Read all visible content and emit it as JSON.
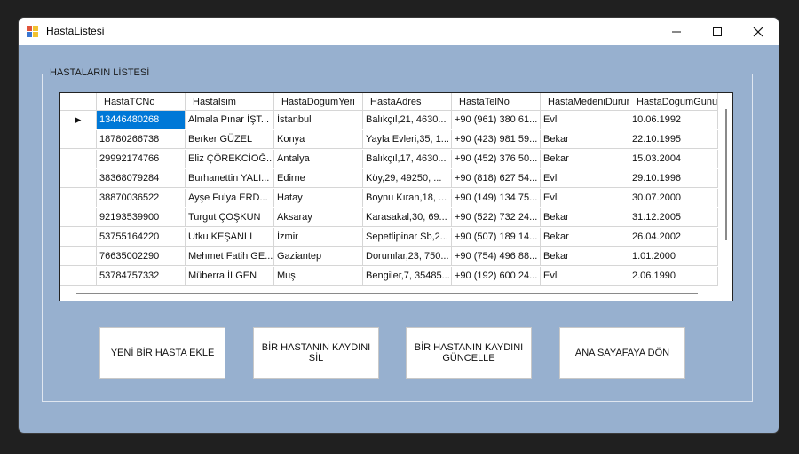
{
  "window": {
    "title": "HastaListesi"
  },
  "controls": {
    "minimize": "—",
    "maximize": "☐",
    "close": "✕"
  },
  "group": {
    "label": "HASTALARIN LİSTESİ"
  },
  "grid": {
    "columns": [
      "HastaTCNo",
      "HastaIsim",
      "HastaDogumYeri",
      "HastaAdres",
      "HastaTelNo",
      "HastaMedeniDurum",
      "HastaDogumGunu"
    ],
    "rows": [
      [
        "13446480268",
        "Almala Pınar İŞT...",
        "İstanbul",
        "Balıkçıl,21, 4630...",
        "+90 (961) 380 61...",
        "Evli",
        "10.06.1992"
      ],
      [
        "18780266738",
        "Berker GÜZEL",
        "Konya",
        "Yayla Evleri,35, 1...",
        "+90 (423) 981 59...",
        "Bekar",
        "22.10.1995"
      ],
      [
        "29992174766",
        "Eliz ÇÖREKCİOĞ...",
        "Antalya",
        "Balıkçıl,17, 4630...",
        "+90 (452) 376 50...",
        "Bekar",
        "15.03.2004"
      ],
      [
        "38368079284",
        "Burhanettin YALI...",
        "Edirne",
        "Köy,29, 49250, ...",
        "+90 (818) 627 54...",
        "Evli",
        "29.10.1996"
      ],
      [
        "38870036522",
        "Ayşe Fulya ERD...",
        "Hatay",
        "Boynu Kıran,18, ...",
        "+90 (149) 134 75...",
        "Evli",
        "30.07.2000"
      ],
      [
        "92193539900",
        "Turgut ÇOŞKUN",
        "Aksaray",
        "Karasakal,30, 69...",
        "+90 (522) 732 24...",
        "Bekar",
        "31.12.2005"
      ],
      [
        "53755164220",
        "Utku KEŞANLI",
        "İzmir",
        "Sepetlipinar Sb,2...",
        "+90 (507) 189 14...",
        "Bekar",
        "26.04.2002"
      ],
      [
        "76635002290",
        "Mehmet Fatih GE...",
        "Gaziantep",
        "Dorumlar,23, 750...",
        "+90 (754) 496 88...",
        "Bekar",
        "1.01.2000"
      ],
      [
        "53784757332",
        "Müberra İLGEN",
        "Muş",
        "Bengiler,7, 35485...",
        "+90 (192) 600 24...",
        "Evli",
        "2.06.1990"
      ]
    ],
    "current_row_marker": "▶"
  },
  "buttons": {
    "add": "YENİ BİR HASTA EKLE",
    "delete": "BİR HASTANIN KAYDINI SİL",
    "update": "BİR HASTANIN KAYDINI GÜNCELLE",
    "home": "ANA SAYAFAYA DÖN"
  },
  "colors": {
    "form_background": "#97b0cf",
    "selection": "#0078d7",
    "icon_red": "#e0533b",
    "icon_yellow": "#f2c230",
    "icon_blue": "#3a76d1"
  }
}
